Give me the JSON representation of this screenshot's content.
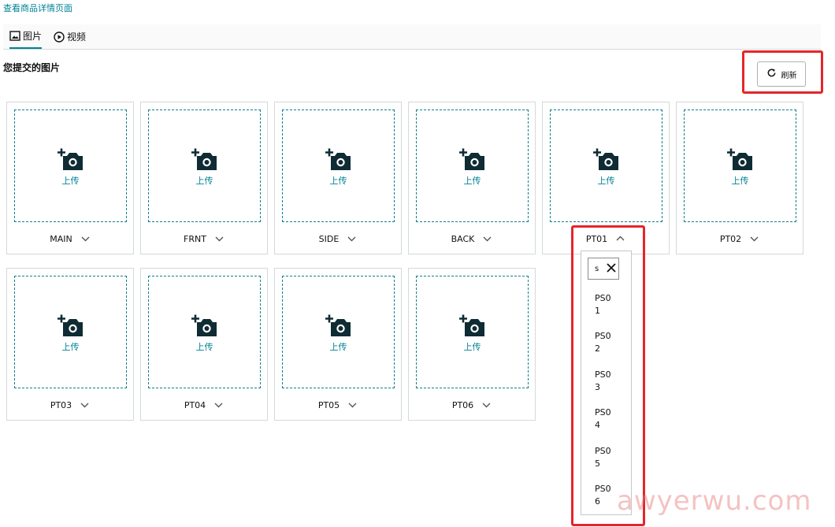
{
  "header": {
    "link_text": "查看商品详情页面"
  },
  "tabs": [
    {
      "label": "图片",
      "icon": "image-icon",
      "active": true
    },
    {
      "label": "视频",
      "icon": "play-icon",
      "active": false
    }
  ],
  "section": {
    "title": "您提交的图片"
  },
  "refresh": {
    "label": "刷新",
    "icon": "refresh-icon"
  },
  "slots": [
    {
      "label": "MAIN",
      "upload": "上传"
    },
    {
      "label": "FRNT",
      "upload": "上传"
    },
    {
      "label": "SIDE",
      "upload": "上传"
    },
    {
      "label": "BACK",
      "upload": "上传"
    },
    {
      "label": "PT01",
      "upload": "上传",
      "expanded": true
    },
    {
      "label": "PT02",
      "upload": "上传"
    },
    {
      "label": "PT03",
      "upload": "上传"
    },
    {
      "label": "PT04",
      "upload": "上传"
    },
    {
      "label": "PT05",
      "upload": "上传"
    },
    {
      "label": "PT06",
      "upload": "上传"
    }
  ],
  "dropdown": {
    "search_value": "s",
    "options": [
      "PS01",
      "PS02",
      "PS03",
      "PS04",
      "PS05",
      "PS06"
    ]
  },
  "watermark": "awyerwu.com",
  "colors": {
    "accent": "#008296",
    "highlight": "#e4262a",
    "icon": "#0f2b33"
  }
}
